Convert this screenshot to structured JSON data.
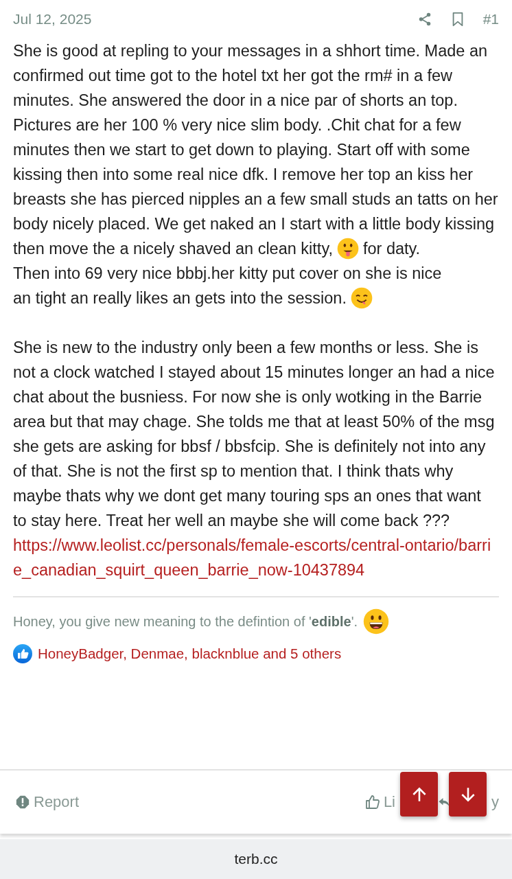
{
  "post": {
    "date": "Jul 12, 2025",
    "number": "#1",
    "paragraphs": [
      [
        {
          "kind": "text",
          "text": "She is good at repling to your messages in a shhort time. Made an confirmed out time got to the hotel txt her got the rm# in a few minutes. She answered the door in a nice par of shorts an top. Pictures are her 100 % very nice slim body. .Chit chat for a few minutes then we start to get down to playing. Start off with some kissing then into some real nice dfk. I remove her top an kiss her breasts she has pierced nipples an a few small studs an tatts on her body nicely placed. We get naked an I start with a little body kissing"
        },
        {
          "kind": "row",
          "parts": [
            {
              "kind": "text",
              "text": "then move the a nicely shaved an clean kitty,"
            },
            {
              "kind": "emoji"
            },
            {
              "kind": "text",
              "text": "for daty."
            }
          ]
        },
        {
          "kind": "text",
          "text": "Then into 69 very nice bbbj.her kitty put cover on she is nice"
        },
        {
          "kind": "row",
          "parts": [
            {
              "kind": "text",
              "text": "an tight an really likes an gets into the session."
            },
            {
              "kind": "emoji"
            }
          ]
        }
      ],
      [
        {
          "kind": "text",
          "text": "She is new to the industry only been a few months or less. She is not a clock watched I stayed about 15 minutes longer an had a nice chat about the busniess. For now she is only wotking in the Barrie area but that may chage. She tolds me that at least 50% of the msg she gets are asking for bbsf / bbsfcip. She is definitely not into any of that. She is not the first sp to mention that. I think thats why maybe thats why we dont get many touring sps an ones that want to stay here. Treat her well an maybe she will come back ???"
        },
        {
          "kind": "link",
          "text": "https://www.leolist.cc/personals/female-escorts/central-ontario/barrie_canadian_squirt_queen_barrie_now-10437894"
        }
      ]
    ],
    "signature": {
      "text": "Honey, you give new meaning to the defintion of '**edible**'."
    },
    "likes": "HoneyBadger, Denmae, blacknblue and 5 others",
    "actions": {
      "report": "Report",
      "like": "Li",
      "reply": "y"
    }
  },
  "browser": {
    "url": "terb.cc"
  }
}
